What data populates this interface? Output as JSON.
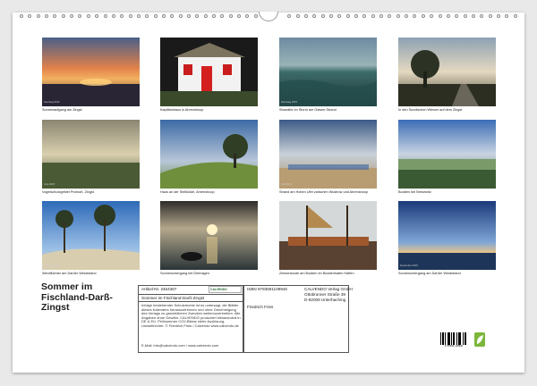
{
  "calendar": {
    "title": "Sommer im Fischland-Darß-Zingst",
    "photos": [
      {
        "caption": "Sonnenaufgang am Zingst",
        "date": "Sonntag 2015"
      },
      {
        "caption": "Kapitänshaus in Ahrenshoop",
        "date": ""
      },
      {
        "caption": "Strandtür im Sturm am Ostsee-Strand",
        "date": "Dienstag 2015"
      },
      {
        "caption": "In den Sundischen Wiesen auf dem Zingst",
        "date": ""
      },
      {
        "caption": "Vogelschutzgebiet Pramort, Zingst",
        "date": "Juni 2015"
      },
      {
        "caption": "Haus an der Steilküste, Ahrenshoop",
        "date": ""
      },
      {
        "caption": "Strand am Hohen Ufer zwischen Wustrow und Ahrenshoop",
        "date": "Juli 2015"
      },
      {
        "caption": "Bodden bei Bresewitz",
        "date": ""
      },
      {
        "caption": "Windflüchter am Darßer Weststrand",
        "date": "Februar 2015"
      },
      {
        "caption": "Sonnenuntergang bei Dierhagen",
        "date": ""
      },
      {
        "caption": "Zeesenboote am Bodden im Boddenhafen Haften",
        "date": ""
      },
      {
        "caption": "Sonnenuntergang am Darßer Weststrand",
        "date": "Dezember 2015"
      }
    ]
  },
  "info": {
    "article_label": "Artikel-Nr. 2454367",
    "logo_text": "CALVENDO",
    "isbn": "ISBN 9783591109946",
    "publisher_name": "CALVENDO Verlag GmbH",
    "publisher_street": "Ottobrunner Straße 39",
    "publisher_city": "D-82008 Unterhaching",
    "title_repeat": "Sommer im Fischland-Darß-Zingst",
    "author": "Friedrich Fries",
    "disclaimer": "Infolge bestehender Schutzrechte ist es untersagt, die Blätter dieses Kalenders herauszutrennen und ohne Genehmigung des Verlags zu gewerblichen Zwecken weiterzuverbreiten. Alle Angaben ohne Gewähr. CALVENDO produziert klimaneutral in DE & EU. Prüfnummer CO2-Bilanz siehe Auslösung, Umweltrechte. © Friedrich Fries / Calvendo www.calvendo.de",
    "email": "E-Mail: info@calvendo.com / www.calvendo.com",
    "barcode_number": "9 783591 109946"
  }
}
